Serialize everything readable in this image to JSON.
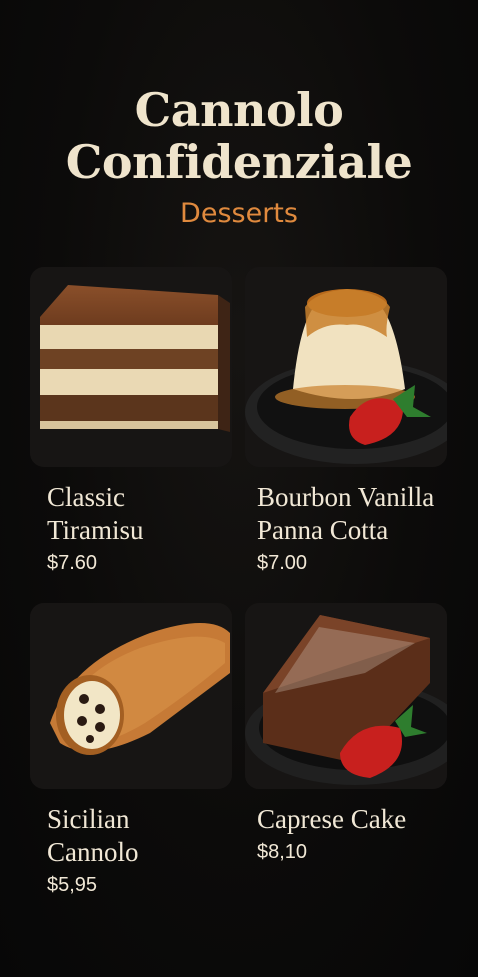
{
  "restaurant": {
    "name": "Cannolo Confidenziale",
    "section": "Desserts"
  },
  "items": [
    {
      "name": "Classic\nTiramisu",
      "price": "$7.60"
    },
    {
      "name": "Bourbon Vanilla\nPanna Cotta",
      "price": "$7.00"
    },
    {
      "name": "Sicilian\nCannolo",
      "price": "$5,95"
    },
    {
      "name": "Caprese Cake",
      "price": "$8,10"
    }
  ],
  "colors": {
    "title": "#efe4cc",
    "accent": "#e08a3e",
    "background": "#0b0a09"
  }
}
